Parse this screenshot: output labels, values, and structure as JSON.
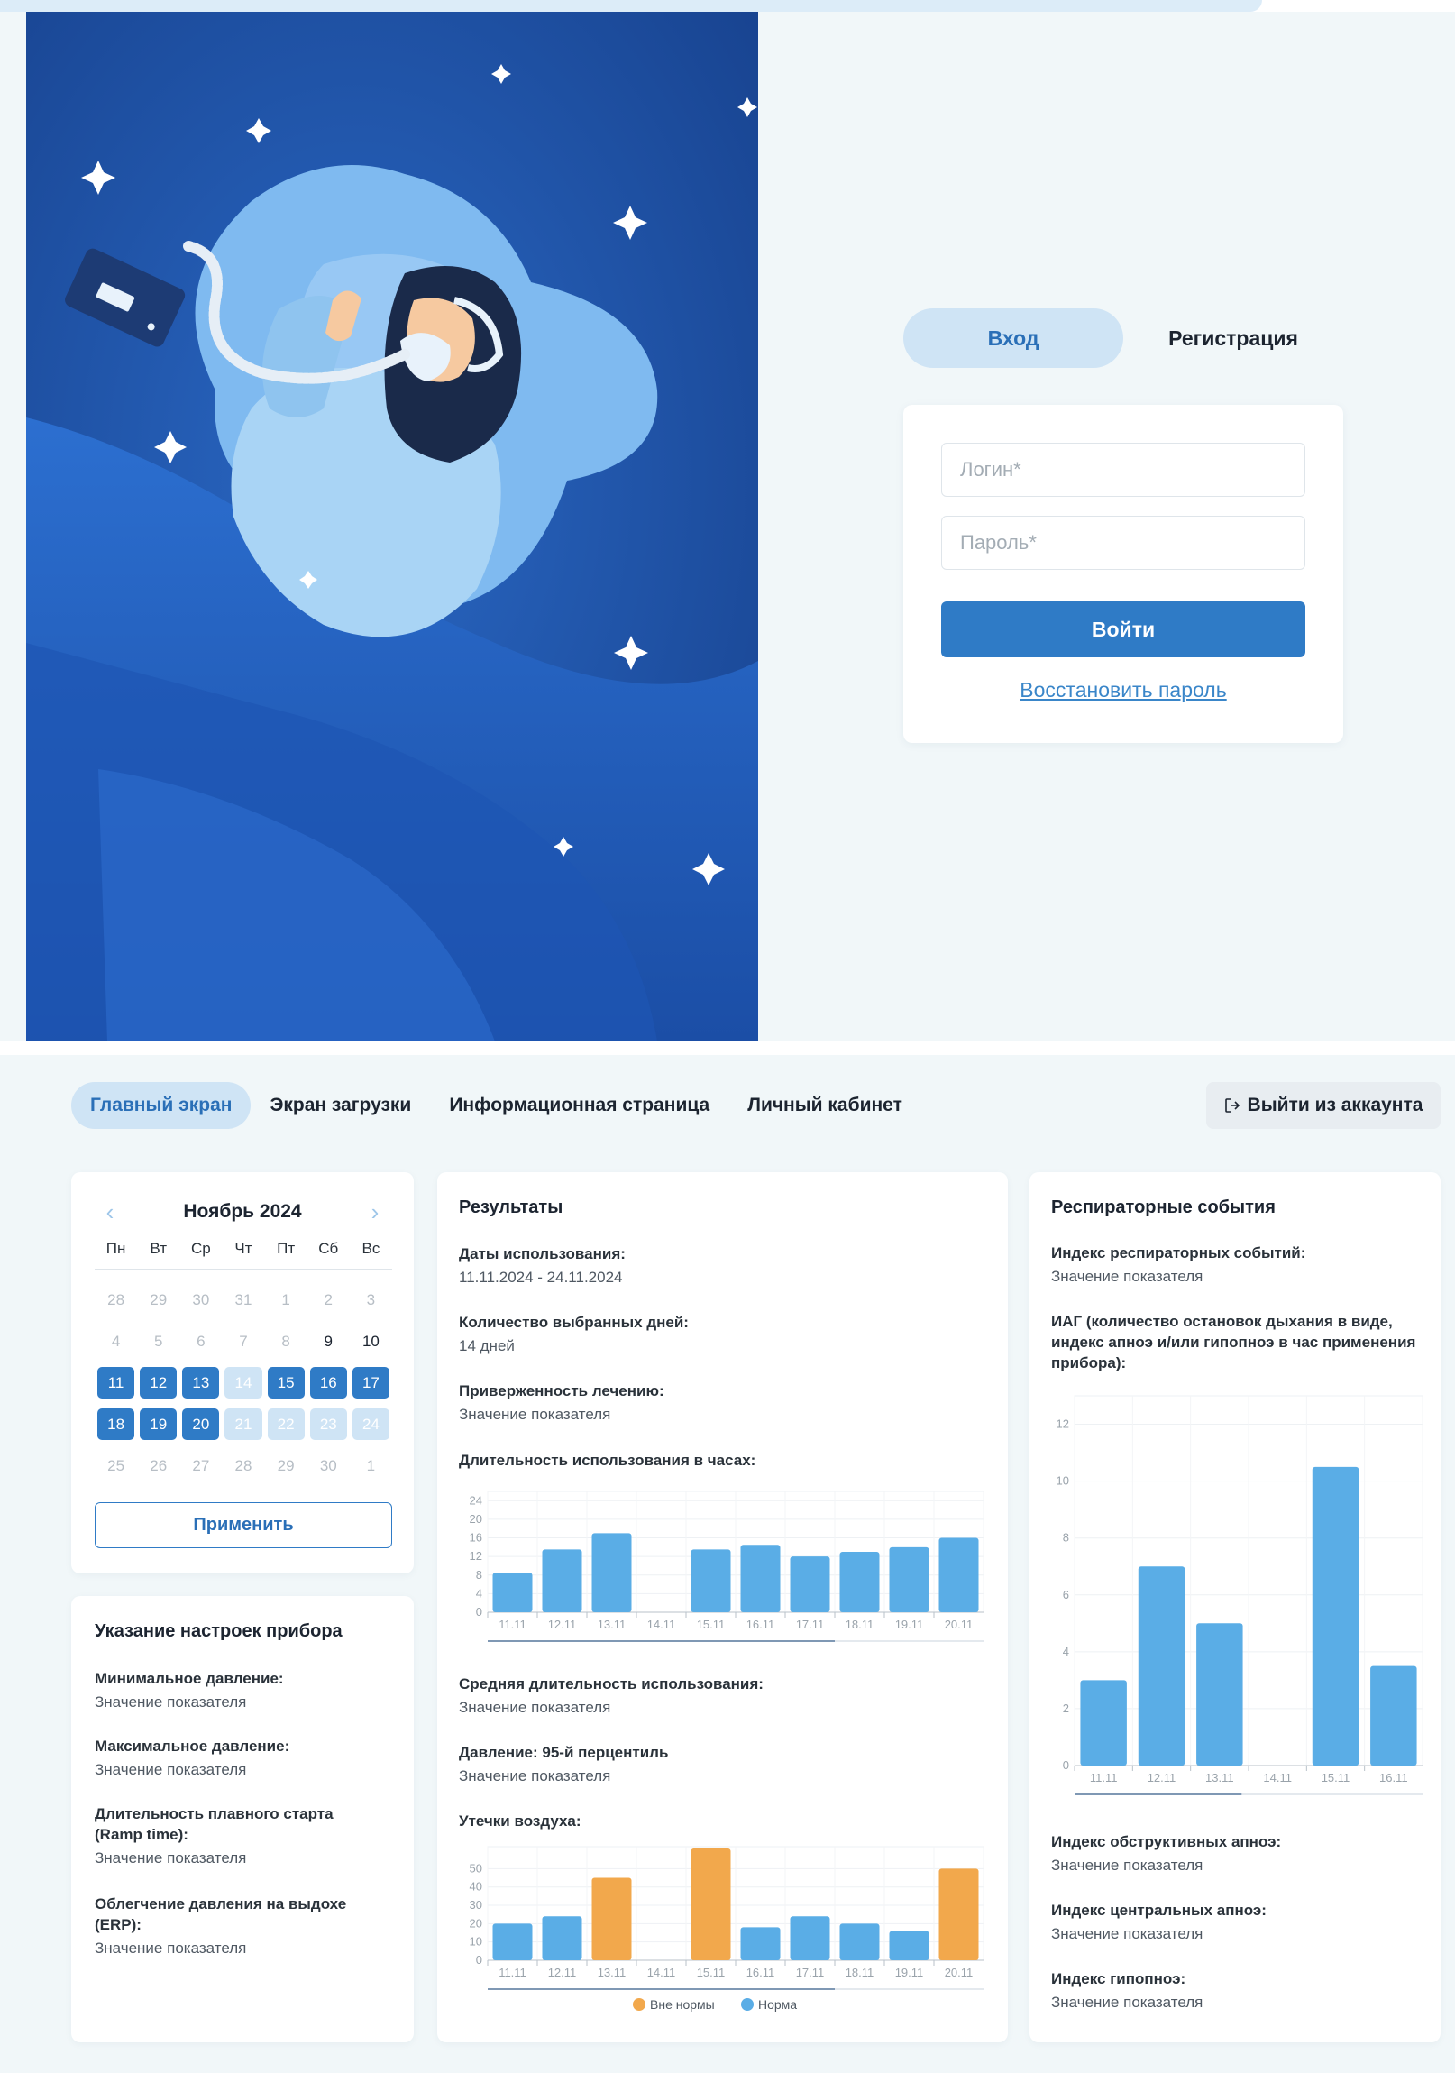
{
  "login": {
    "tab_login": "Вход",
    "tab_register": "Регистрация",
    "login_placeholder": "Логин*",
    "password_placeholder": "Пароль*",
    "submit_label": "Войти",
    "restore_label": "Восстановить пароль"
  },
  "nav": {
    "items": [
      "Главный экран",
      "Экран загрузки",
      "Информационная страница",
      "Личный кабинет"
    ],
    "active_index": 0,
    "logout_label": "Выйти из аккаунта"
  },
  "calendar": {
    "title": "Ноябрь 2024",
    "weekdays": [
      "Пн",
      "Вт",
      "Ср",
      "Чт",
      "Пт",
      "Сб",
      "Вс"
    ],
    "days": [
      {
        "d": "28",
        "s": "muted"
      },
      {
        "d": "29",
        "s": "muted"
      },
      {
        "d": "30",
        "s": "muted"
      },
      {
        "d": "31",
        "s": "muted"
      },
      {
        "d": "1",
        "s": "muted"
      },
      {
        "d": "2",
        "s": "muted"
      },
      {
        "d": "3",
        "s": "muted"
      },
      {
        "d": "4",
        "s": "muted"
      },
      {
        "d": "5",
        "s": "muted"
      },
      {
        "d": "6",
        "s": "muted"
      },
      {
        "d": "7",
        "s": "muted"
      },
      {
        "d": "8",
        "s": "muted"
      },
      {
        "d": "9",
        "s": "normal"
      },
      {
        "d": "10",
        "s": "normal"
      },
      {
        "d": "11",
        "s": "sel"
      },
      {
        "d": "12",
        "s": "sel"
      },
      {
        "d": "13",
        "s": "sel"
      },
      {
        "d": "14",
        "s": "sel-light"
      },
      {
        "d": "15",
        "s": "sel"
      },
      {
        "d": "16",
        "s": "sel"
      },
      {
        "d": "17",
        "s": "sel"
      },
      {
        "d": "18",
        "s": "sel"
      },
      {
        "d": "19",
        "s": "sel"
      },
      {
        "d": "20",
        "s": "sel"
      },
      {
        "d": "21",
        "s": "sel-light"
      },
      {
        "d": "22",
        "s": "sel-light"
      },
      {
        "d": "23",
        "s": "sel-light"
      },
      {
        "d": "24",
        "s": "sel-light"
      },
      {
        "d": "25",
        "s": "muted"
      },
      {
        "d": "26",
        "s": "muted"
      },
      {
        "d": "27",
        "s": "muted"
      },
      {
        "d": "28",
        "s": "muted"
      },
      {
        "d": "29",
        "s": "muted"
      },
      {
        "d": "30",
        "s": "muted"
      },
      {
        "d": "1",
        "s": "muted"
      }
    ],
    "apply_label": "Применить",
    "prev_icon": "chevron-left-icon",
    "next_icon": "chevron-right-icon"
  },
  "settings": {
    "title": "Указание настроек прибора",
    "items": [
      {
        "label": "Минимальное давление:",
        "value": "Значение показателя"
      },
      {
        "label": "Максимальное давление:",
        "value": "Значение показателя"
      },
      {
        "label": "Длительность плавного старта (Ramp time):",
        "value": "Значение показателя"
      },
      {
        "label": "Облегчение давления на выдохе (ERP):",
        "value": "Значение показателя"
      }
    ]
  },
  "results": {
    "title": "Результаты",
    "dates_label": "Даты использования:",
    "dates_value": "11.11.2024 - 24.11.2024",
    "days_label": "Количество выбранных дней:",
    "days_value": "14 дней",
    "adherence_label": "Приверженность лечению:",
    "adherence_value": "Значение показателя",
    "usage_chart_label": "Длительность использования в часах:",
    "avg_label": "Средняя длительность использования:",
    "avg_value": "Значение показателя",
    "pressure_label": "Давление: 95-й перцентиль",
    "pressure_value": "Значение показателя",
    "leak_chart_label": "Утечки воздуха:"
  },
  "respiratory": {
    "title": "Респираторные события",
    "index_label": "Индекс респираторных событий:",
    "index_value": "Значение показателя",
    "ahi_label": "ИАГ (количество остановок дыхания в виде, индекс апноэ и/или гипопноэ в час применения прибора):",
    "obstructive_label": "Индекс обструктивных апноэ:",
    "obstructive_value": "Значение показателя",
    "central_label": "Индекс центральных апноэ:",
    "central_value": "Значение показателя",
    "hypopnea_label": "Индекс гипопноэ:",
    "hypopnea_value": "Значение показателя"
  },
  "colors": {
    "accent": "#2f7bc6",
    "bar_normal": "#5aade6",
    "bar_out": "#f2a84c",
    "active_tab_bg": "#cfe4f5",
    "illustration_bg": "#1a4fa0"
  },
  "chart_data": [
    {
      "type": "bar",
      "categories": [
        "11.11",
        "12.11",
        "13.11",
        "14.11",
        "15.11",
        "16.11",
        "17.11",
        "18.11",
        "19.11",
        "20.11"
      ],
      "values": [
        8.5,
        13.5,
        17,
        null,
        13.5,
        14.5,
        12,
        13,
        14,
        16
      ],
      "yticks": [
        0,
        4,
        8,
        12,
        16,
        20,
        24
      ],
      "ylim": [
        0,
        26
      ],
      "grid": true
    },
    {
      "type": "bar",
      "categories": [
        "11.11",
        "12.11",
        "13.11",
        "14.11",
        "15.11",
        "16.11",
        "17.11",
        "18.11",
        "19.11",
        "20.11"
      ],
      "values": [
        20,
        24,
        45,
        null,
        61,
        18,
        24,
        20,
        16,
        50
      ],
      "status": [
        "norm",
        "norm",
        "out",
        null,
        "out",
        "norm",
        "norm",
        "norm",
        "norm",
        "out"
      ],
      "yticks": [
        0,
        10,
        20,
        30,
        40,
        50
      ],
      "ylim": [
        0,
        62
      ],
      "grid": true,
      "legend": [
        {
          "name": "Вне нормы",
          "key": "out"
        },
        {
          "name": "Норма",
          "key": "norm"
        }
      ],
      "legend_placement": "bottom"
    },
    {
      "type": "bar",
      "categories": [
        "11.11",
        "12.11",
        "13.11",
        "14.11",
        "15.11",
        "16.11"
      ],
      "values": [
        3,
        7,
        5,
        null,
        10.5,
        3.5
      ],
      "yticks": [
        0,
        2,
        4,
        6,
        8,
        10,
        12
      ],
      "ylim": [
        0,
        13
      ],
      "grid": true
    }
  ]
}
